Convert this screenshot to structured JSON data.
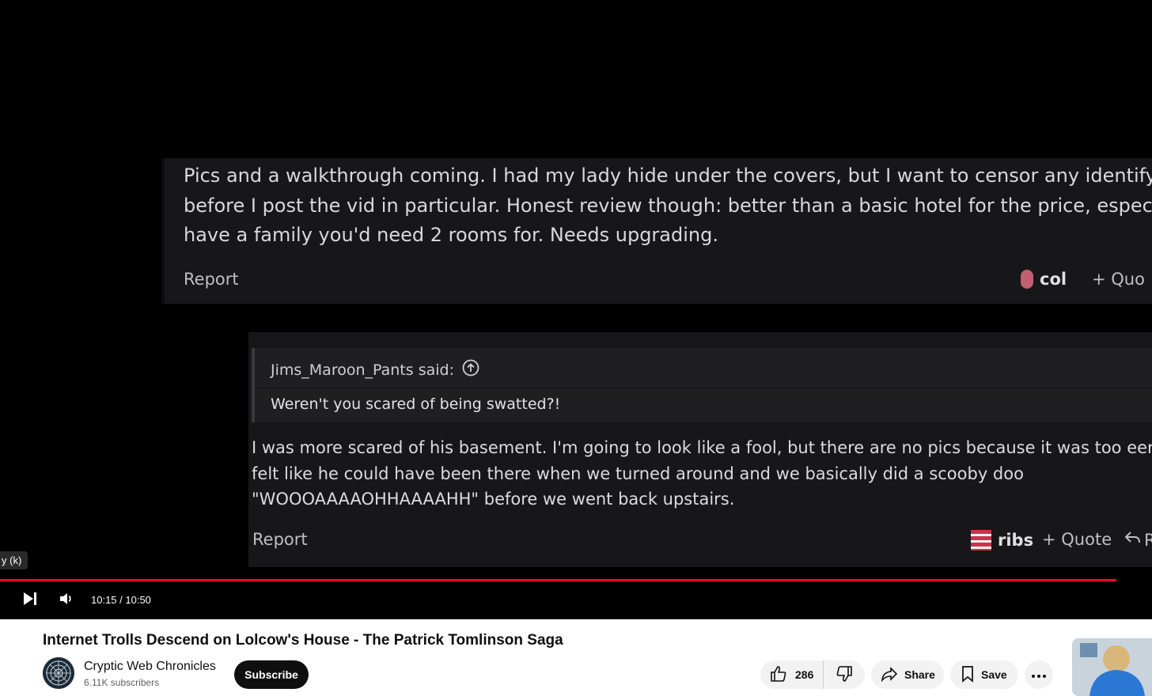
{
  "forum": {
    "post": {
      "lines": [
        "Pics and a walkthrough coming. I had my lady hide under the covers, but I want to censor any identifying",
        "before I post the vid in particular. Honest review though: better than a basic hotel for the price, especiall",
        "have a family you'd need 2 rooms for. Needs upgrading."
      ],
      "report": "Report",
      "reactor": "col",
      "quote": "+ Quo"
    },
    "reply": {
      "quoted_author": "Jims_Maroon_Pants said:",
      "quoted_text": "Weren't you scared of being swatted?!",
      "lines": [
        "I was more scared of his basement. I'm going to look like a fool, but there are no pics because it was too eerie.",
        "felt like he could have been there when we turned around and we basically did a scooby doo",
        "\"WOOOAAAAOHHAAAAHH\" before we went back upstairs."
      ],
      "report": "Report",
      "reactor": "ribs",
      "quote": "+ Quote",
      "reply_label": "R"
    }
  },
  "player": {
    "tooltip": "y (k)",
    "time": "10:15 / 10:50",
    "progress": 0.9692,
    "accent": "#ff0033"
  },
  "video": {
    "title": "Internet Trolls Descend on Lolcow's House - The Patrick Tomlinson Saga",
    "channel": "Cryptic Web Chronicles",
    "subscribers": "6.11K subscribers",
    "subscribe": "Subscribe",
    "likes": "286",
    "share": "Share",
    "save": "Save"
  },
  "icons": [
    "next-icon",
    "volume-icon",
    "thumbs-up-icon",
    "thumbs-down-icon",
    "share-icon",
    "bookmark-icon",
    "more-icon",
    "arrow-up-circle-icon",
    "reply-icon"
  ]
}
